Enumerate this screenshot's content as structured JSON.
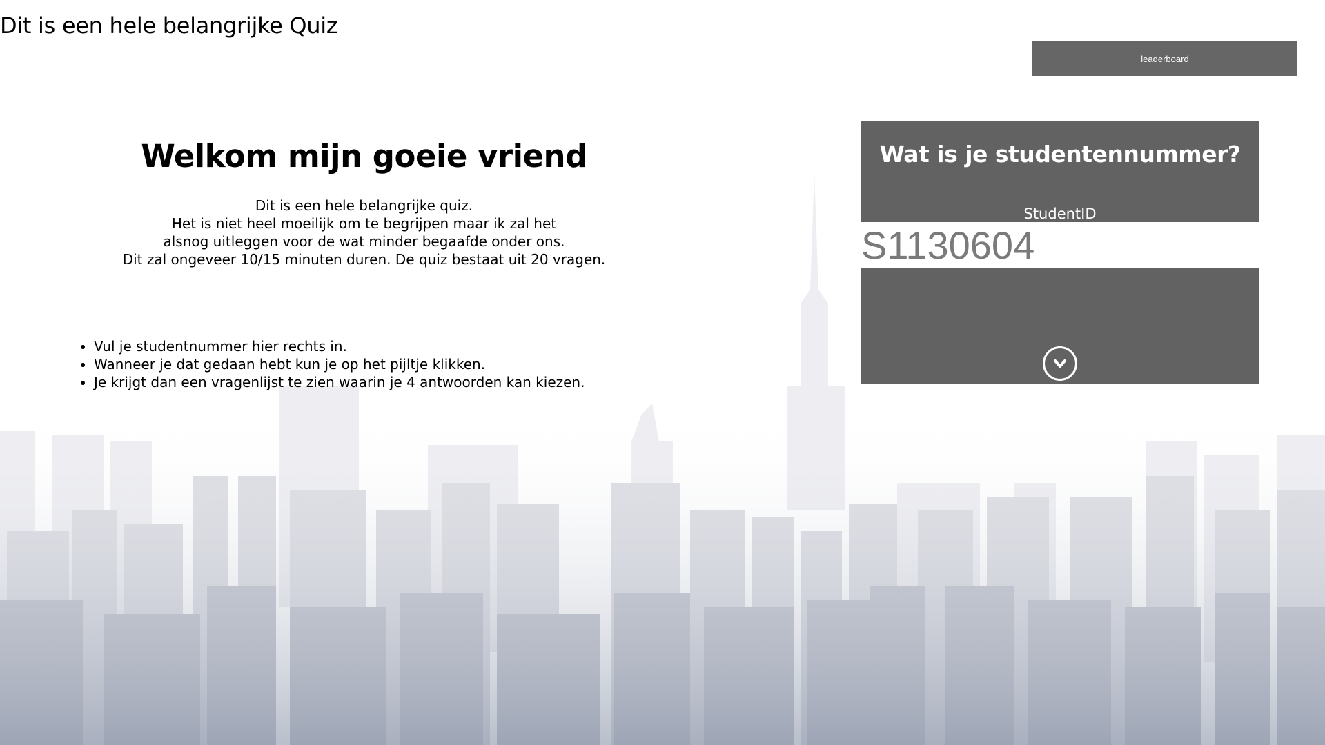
{
  "header": {
    "title": "Dit is een hele belangrijke Quiz",
    "leaderboard_label": "leaderboard"
  },
  "welcome": {
    "heading": "Welkom mijn goeie vriend",
    "intro_lines": [
      "Dit is een hele belangrijke quiz.",
      "Het is niet heel moeilijk om te begrijpen maar ik zal het",
      "alsnog uitleggen voor de wat minder begaafde onder ons.",
      "Dit zal ongeveer 10/15 minuten duren. De quiz bestaat uit 20 vragen."
    ]
  },
  "instructions": [
    "Vul je studentnummer hier rechts in.",
    "Wanneer je dat gedaan hebt kun je op het pijltje klikken.",
    "Je krijgt dan een vragenlijst te zien waarin je 4 antwoorden kan kiezen."
  ],
  "login": {
    "question": "Wat is je studentennummer?",
    "field_label": "StudentID",
    "student_id_value": "S1130604",
    "submit_icon": "chevron-down-circle-icon"
  },
  "colors": {
    "panel": "#626262",
    "button": "#666666",
    "input_text": "#7a7a7a",
    "skyline_bottom": "#7f8aa0"
  }
}
